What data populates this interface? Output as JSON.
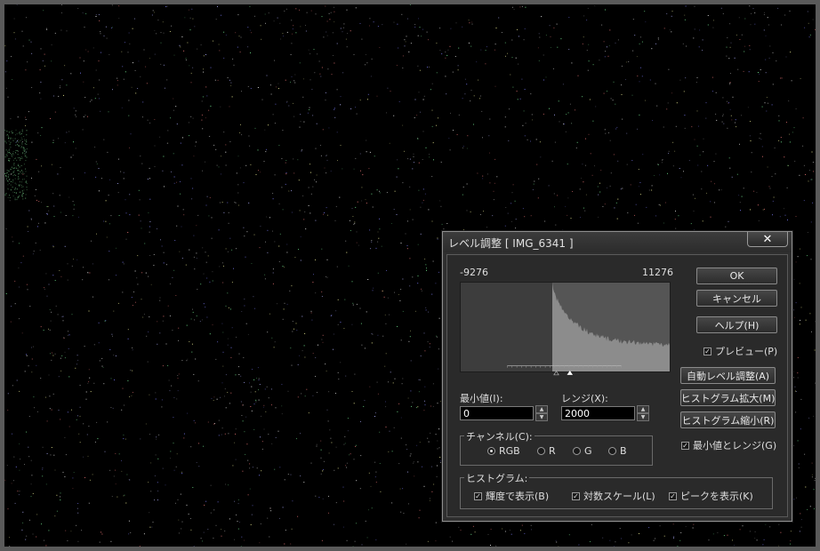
{
  "dialog": {
    "title": "レベル調整 [ IMG_6341 ]",
    "close_glyph": "✕",
    "histogram": {
      "min_label": "-9276",
      "max_label": "11276"
    },
    "min_value": {
      "label": "最小値(I):",
      "value": "0"
    },
    "range_value": {
      "label": "レンジ(X):",
      "value": "2000"
    },
    "channel": {
      "group_label": "チャンネル(C):",
      "options": [
        {
          "label": "RGB",
          "selected": true
        },
        {
          "label": "R",
          "selected": false
        },
        {
          "label": "G",
          "selected": false
        },
        {
          "label": "B",
          "selected": false
        }
      ]
    },
    "histogram_group": {
      "group_label": "ヒストグラム:",
      "options": [
        {
          "label": "輝度で表示(B)",
          "checked": true
        },
        {
          "label": "対数スケール(L)",
          "checked": true
        },
        {
          "label": "ピークを表示(K)",
          "checked": true
        }
      ]
    },
    "buttons": {
      "ok": "OK",
      "cancel": "キャンセル",
      "help": "ヘルプ(H)",
      "auto_level": "自動レベル調整(A)",
      "hist_expand": "ヒストグラム拡大(M)",
      "hist_shrink": "ヒストグラム縮小(R)"
    },
    "preview": {
      "label": "プレビュー(P)",
      "checked": true
    },
    "min_range": {
      "label": "最小値とレンジ(G)",
      "checked": true
    }
  },
  "colors": {
    "canvas": "#000000",
    "frame": "#5a5a5a",
    "dialog_bg": "#2a2a2a",
    "histogram_fill": "#8c8c8c"
  }
}
